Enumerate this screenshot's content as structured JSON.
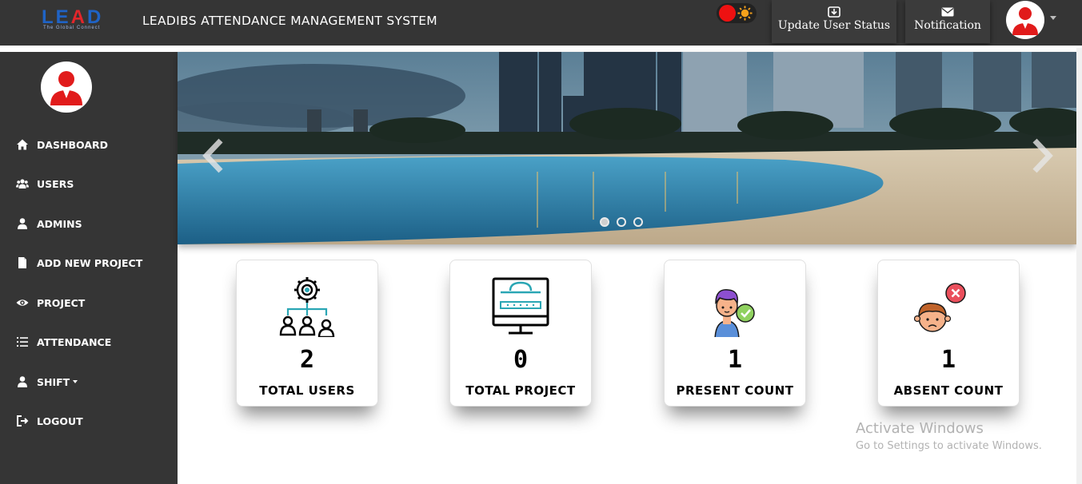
{
  "header": {
    "logo_text": "LEAD",
    "logo_tagline": "The Global Connect",
    "title": "LEADIBS ATTENDANCE MANAGEMENT SYSTEM",
    "update_status_label": "Update User Status",
    "notification_label": "Notification",
    "toggle_state": "dark-mode-on"
  },
  "sidebar": {
    "items": [
      {
        "label": "DASHBOARD",
        "icon": "home-icon"
      },
      {
        "label": "USERS",
        "icon": "users-icon"
      },
      {
        "label": "ADMINS",
        "icon": "user-icon"
      },
      {
        "label": "ADD NEW PROJECT",
        "icon": "file-icon"
      },
      {
        "label": "PROJECT",
        "icon": "eye-icon"
      },
      {
        "label": "ATTENDANCE",
        "icon": "list-icon"
      },
      {
        "label": "SHIFT",
        "icon": "user-icon"
      },
      {
        "label": "LOGOUT",
        "icon": "logout-icon"
      }
    ]
  },
  "carousel": {
    "slides": 3,
    "active_slide": 1
  },
  "stats": [
    {
      "value": "2",
      "label": "TOTAL USERS",
      "icon": "team-hierarchy-icon"
    },
    {
      "value": "0",
      "label": "TOTAL PROJECT",
      "icon": "monitor-icon"
    },
    {
      "value": "1",
      "label": "PRESENT COUNT",
      "icon": "present-person-icon"
    },
    {
      "value": "1",
      "label": "ABSENT COUNT",
      "icon": "absent-person-icon"
    }
  ],
  "watermark": {
    "line1": "Activate Windows",
    "line2": "Go to Settings to activate Windows."
  },
  "colors": {
    "bar_bg": "#353535",
    "brand_blue": "#1f63c6",
    "brand_red": "#e2262b",
    "avatar_red": "#e11b1b"
  }
}
